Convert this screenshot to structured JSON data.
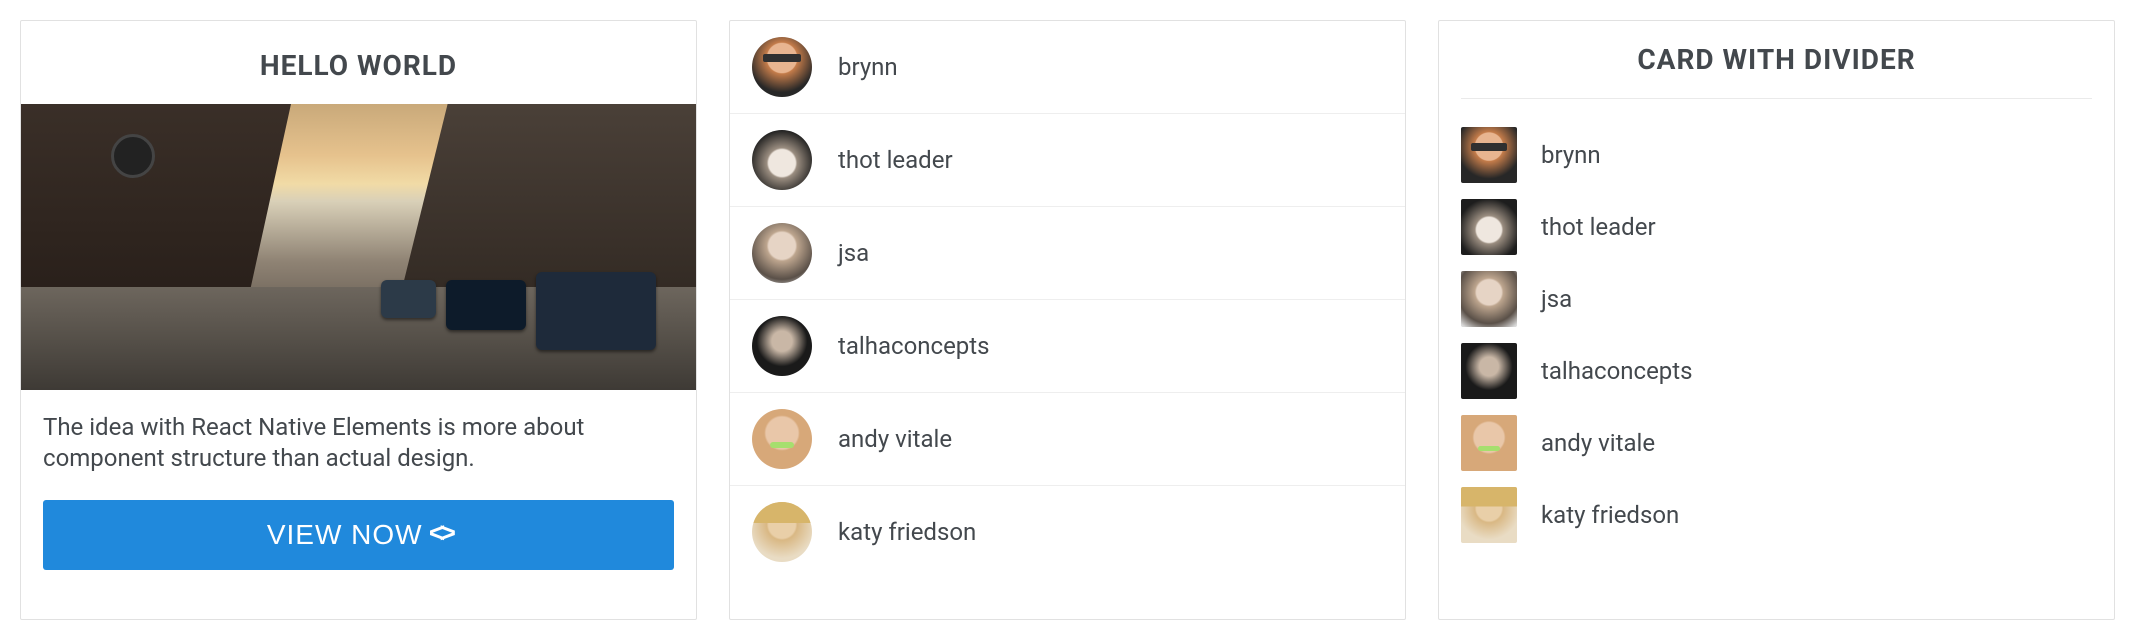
{
  "card1": {
    "title": "HELLO WORLD",
    "description": "The idea with React Native Elements is more about component structure than actual design.",
    "button_label": "VIEW NOW"
  },
  "list": {
    "items": [
      {
        "name": "brynn"
      },
      {
        "name": "thot leader"
      },
      {
        "name": "jsa"
      },
      {
        "name": "talhaconcepts"
      },
      {
        "name": "andy vitale"
      },
      {
        "name": "katy friedson"
      }
    ]
  },
  "card3": {
    "title": "CARD WITH DIVIDER",
    "items": [
      {
        "name": "brynn"
      },
      {
        "name": "thot leader"
      },
      {
        "name": "jsa"
      },
      {
        "name": "talhaconcepts"
      },
      {
        "name": "andy vitale"
      },
      {
        "name": "katy friedson"
      }
    ]
  }
}
